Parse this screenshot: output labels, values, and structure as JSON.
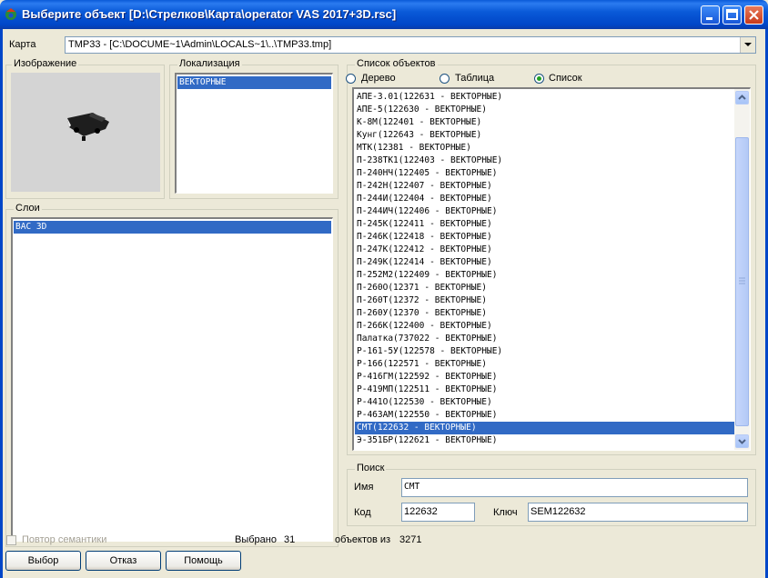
{
  "window": {
    "title": "Выберите объект [D:\\Стрелков\\Карта\\operator VAS 2017+3D.rsc]"
  },
  "map": {
    "label": "Карта",
    "value": "TMP33 - [C:\\DOCUME~1\\Admin\\LOCALS~1\\..\\TMP33.tmp]"
  },
  "image_group": {
    "title": "Изображение"
  },
  "localization": {
    "title": "Локализация",
    "items": [
      "ВЕКТОРНЫЕ"
    ]
  },
  "layers": {
    "title": "Слои",
    "items": [
      "ВАС 3D"
    ]
  },
  "objects": {
    "title": "Список объектов",
    "view_modes": [
      {
        "label": "Дерево",
        "selected": false
      },
      {
        "label": "Таблица",
        "selected": false
      },
      {
        "label": "Список",
        "selected": true
      }
    ],
    "items": [
      "АПЕ-3.01(122631 - ВЕКТОРНЫЕ)",
      "АПЕ-5(122630 - ВЕКТОРНЫЕ)",
      "К-8М(122401 - ВЕКТОРНЫЕ)",
      "Кунг(122643 - ВЕКТОРНЫЕ)",
      "МТК(12381 - ВЕКТОРНЫЕ)",
      "П-238ТК1(122403 - ВЕКТОРНЫЕ)",
      "П-240НЧ(122405 - ВЕКТОРНЫЕ)",
      "П-242Н(122407 - ВЕКТОРНЫЕ)",
      "П-244И(122404 - ВЕКТОРНЫЕ)",
      "П-244ИЧ(122406 - ВЕКТОРНЫЕ)",
      "П-245К(122411 - ВЕКТОРНЫЕ)",
      "П-246К(122418 - ВЕКТОРНЫЕ)",
      "П-247К(122412 - ВЕКТОРНЫЕ)",
      "П-249К(122414 - ВЕКТОРНЫЕ)",
      "П-252М2(122409 - ВЕКТОРНЫЕ)",
      "П-260О(12371 - ВЕКТОРНЫЕ)",
      "П-260Т(12372 - ВЕКТОРНЫЕ)",
      "П-260У(12370 - ВЕКТОРНЫЕ)",
      "П-266К(122400 - ВЕКТОРНЫЕ)",
      "Палатка(737022 - ВЕКТОРНЫЕ)",
      "Р-161-5У(122578 - ВЕКТОРНЫЕ)",
      "Р-166(122571 - ВЕКТОРНЫЕ)",
      "Р-416ГМ(122592 - ВЕКТОРНЫЕ)",
      "Р-419МП(122511 - ВЕКТОРНЫЕ)",
      "Р-441О(122530 - ВЕКТОРНЫЕ)",
      "Р-463АМ(122550 - ВЕКТОРНЫЕ)",
      "СМТ(122632 - ВЕКТОРНЫЕ)",
      "Э-351БР(122621 - ВЕКТОРНЫЕ)"
    ],
    "selected_index": 26
  },
  "search": {
    "title": "Поиск",
    "name_label": "Имя",
    "name_value": "СМТ",
    "code_label": "Код",
    "code_value": "122632",
    "key_label": "Ключ",
    "key_value": "SEM122632"
  },
  "status": {
    "repeat_semantics_label": "Повтор семантики",
    "selected_label": "Выбрано",
    "selected_count": "31",
    "objects_of_label": "объектов из",
    "total_count": "3271"
  },
  "buttons": {
    "choose": "Выбор",
    "cancel": "Отказ",
    "help": "Помощь"
  },
  "colors": {
    "selection": "#316ac5",
    "titlebar": "#0a5ad8",
    "face": "#ece9d8"
  }
}
